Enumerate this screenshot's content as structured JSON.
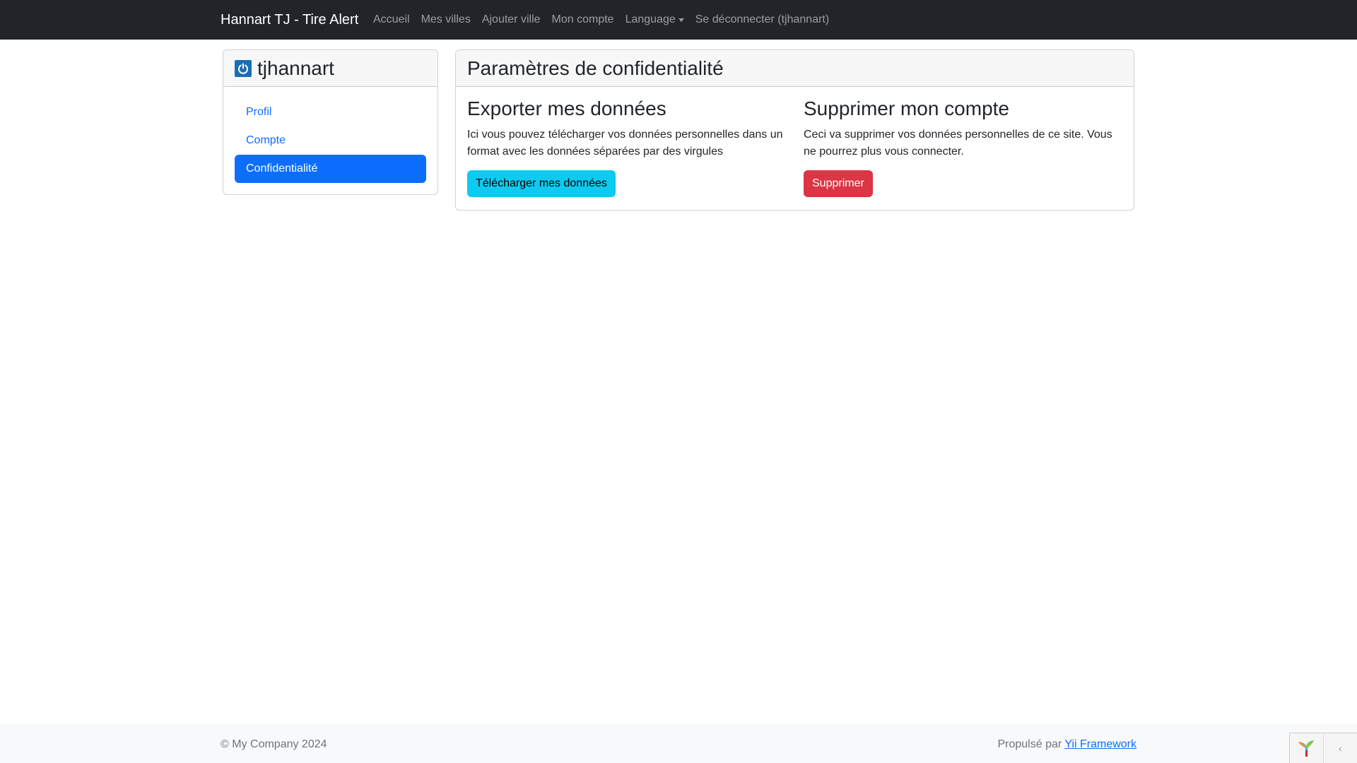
{
  "navbar": {
    "brand": "Hannart TJ - Tire Alert",
    "links": {
      "home": "Accueil",
      "my_cities": "Mes villes",
      "add_city": "Ajouter ville",
      "my_account": "Mon compte",
      "language": "Language",
      "logout": "Se déconnecter (tjhannart)"
    }
  },
  "sidebar": {
    "username": "tjhannart",
    "items": [
      {
        "label": "Profil",
        "active": false
      },
      {
        "label": "Compte",
        "active": false
      },
      {
        "label": "Confidentialité",
        "active": true
      }
    ]
  },
  "main": {
    "title": "Paramètres de confidentialité",
    "export": {
      "heading": "Exporter mes données",
      "description": "Ici vous pouvez télécharger vos données personnelles dans un format avec les données séparées par des virgules",
      "button": "Télécharger mes données"
    },
    "delete": {
      "heading": "Supprimer mon compte",
      "description": "Ceci va supprimer vos données personnelles de ce site. Vous ne pourrez plus vous connecter.",
      "button": "Supprimer"
    }
  },
  "footer": {
    "copyright": "© My Company 2024",
    "powered_prefix": "Propulsé par",
    "powered_link": "Yii Framework"
  },
  "colors": {
    "navbar_bg": "#212529",
    "primary": "#0d6efd",
    "info": "#0dcaf0",
    "danger": "#dc3545"
  }
}
